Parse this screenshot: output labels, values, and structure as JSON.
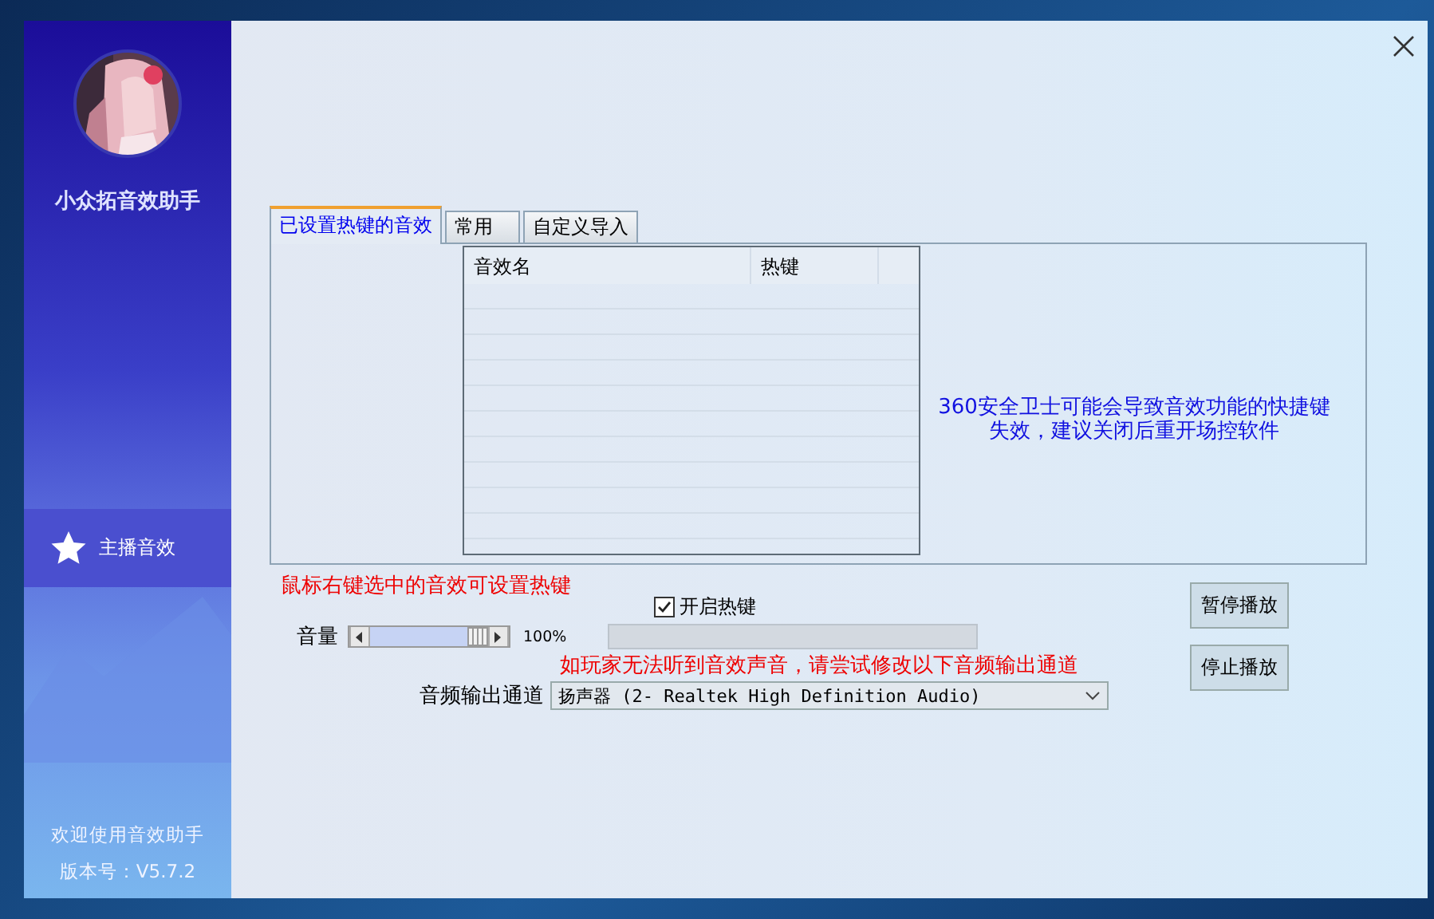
{
  "app": {
    "name": "小众拓音效助手",
    "welcome": "欢迎使用音效助手",
    "version": "版本号：V5.7.2"
  },
  "sidebar": {
    "items": [
      {
        "label": "主播音效",
        "selected": true
      }
    ]
  },
  "tabs": [
    {
      "label": "已设置热键的音效",
      "selected": true
    },
    {
      "label": "常用",
      "selected": false
    },
    {
      "label": "自定义导入",
      "selected": false
    }
  ],
  "table": {
    "columns": [
      "音效名",
      "热键"
    ]
  },
  "notice": "360安全卫士可能会导致音效功能的快捷键失效，建议关闭后重开场控软件",
  "hint": "鼠标右键选中的音效可设置热键",
  "hotkey_toggle": {
    "label": "开启热键",
    "checked": true
  },
  "volume": {
    "label": "音量",
    "level": 1,
    "reading": "100%"
  },
  "warning": "如玩家无法听到音效声音，请尝试修改以下音频输出通道",
  "output": {
    "label": "音频输出通道",
    "value": "扬声器 (2- Realtek High Definition Audio)"
  },
  "buttons": [
    "暂停播放",
    "停止播放"
  ]
}
